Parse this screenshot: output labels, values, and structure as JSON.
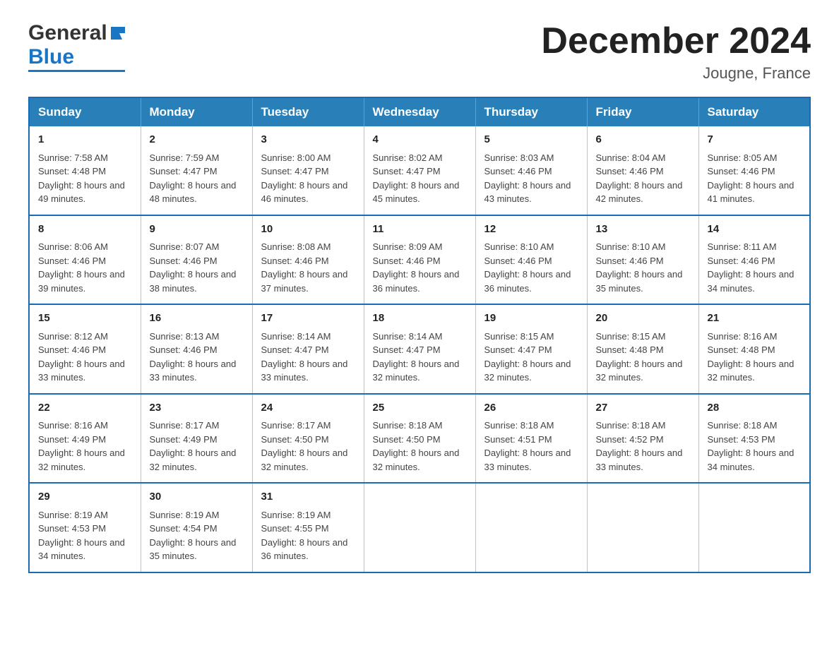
{
  "header": {
    "month_title": "December 2024",
    "location": "Jougne, France",
    "logo_general": "General",
    "logo_blue": "Blue"
  },
  "days_of_week": [
    "Sunday",
    "Monday",
    "Tuesday",
    "Wednesday",
    "Thursday",
    "Friday",
    "Saturday"
  ],
  "weeks": [
    [
      {
        "day": "1",
        "sunrise": "7:58 AM",
        "sunset": "4:48 PM",
        "daylight": "8 hours and 49 minutes."
      },
      {
        "day": "2",
        "sunrise": "7:59 AM",
        "sunset": "4:47 PM",
        "daylight": "8 hours and 48 minutes."
      },
      {
        "day": "3",
        "sunrise": "8:00 AM",
        "sunset": "4:47 PM",
        "daylight": "8 hours and 46 minutes."
      },
      {
        "day": "4",
        "sunrise": "8:02 AM",
        "sunset": "4:47 PM",
        "daylight": "8 hours and 45 minutes."
      },
      {
        "day": "5",
        "sunrise": "8:03 AM",
        "sunset": "4:46 PM",
        "daylight": "8 hours and 43 minutes."
      },
      {
        "day": "6",
        "sunrise": "8:04 AM",
        "sunset": "4:46 PM",
        "daylight": "8 hours and 42 minutes."
      },
      {
        "day": "7",
        "sunrise": "8:05 AM",
        "sunset": "4:46 PM",
        "daylight": "8 hours and 41 minutes."
      }
    ],
    [
      {
        "day": "8",
        "sunrise": "8:06 AM",
        "sunset": "4:46 PM",
        "daylight": "8 hours and 39 minutes."
      },
      {
        "day": "9",
        "sunrise": "8:07 AM",
        "sunset": "4:46 PM",
        "daylight": "8 hours and 38 minutes."
      },
      {
        "day": "10",
        "sunrise": "8:08 AM",
        "sunset": "4:46 PM",
        "daylight": "8 hours and 37 minutes."
      },
      {
        "day": "11",
        "sunrise": "8:09 AM",
        "sunset": "4:46 PM",
        "daylight": "8 hours and 36 minutes."
      },
      {
        "day": "12",
        "sunrise": "8:10 AM",
        "sunset": "4:46 PM",
        "daylight": "8 hours and 36 minutes."
      },
      {
        "day": "13",
        "sunrise": "8:10 AM",
        "sunset": "4:46 PM",
        "daylight": "8 hours and 35 minutes."
      },
      {
        "day": "14",
        "sunrise": "8:11 AM",
        "sunset": "4:46 PM",
        "daylight": "8 hours and 34 minutes."
      }
    ],
    [
      {
        "day": "15",
        "sunrise": "8:12 AM",
        "sunset": "4:46 PM",
        "daylight": "8 hours and 33 minutes."
      },
      {
        "day": "16",
        "sunrise": "8:13 AM",
        "sunset": "4:46 PM",
        "daylight": "8 hours and 33 minutes."
      },
      {
        "day": "17",
        "sunrise": "8:14 AM",
        "sunset": "4:47 PM",
        "daylight": "8 hours and 33 minutes."
      },
      {
        "day": "18",
        "sunrise": "8:14 AM",
        "sunset": "4:47 PM",
        "daylight": "8 hours and 32 minutes."
      },
      {
        "day": "19",
        "sunrise": "8:15 AM",
        "sunset": "4:47 PM",
        "daylight": "8 hours and 32 minutes."
      },
      {
        "day": "20",
        "sunrise": "8:15 AM",
        "sunset": "4:48 PM",
        "daylight": "8 hours and 32 minutes."
      },
      {
        "day": "21",
        "sunrise": "8:16 AM",
        "sunset": "4:48 PM",
        "daylight": "8 hours and 32 minutes."
      }
    ],
    [
      {
        "day": "22",
        "sunrise": "8:16 AM",
        "sunset": "4:49 PM",
        "daylight": "8 hours and 32 minutes."
      },
      {
        "day": "23",
        "sunrise": "8:17 AM",
        "sunset": "4:49 PM",
        "daylight": "8 hours and 32 minutes."
      },
      {
        "day": "24",
        "sunrise": "8:17 AM",
        "sunset": "4:50 PM",
        "daylight": "8 hours and 32 minutes."
      },
      {
        "day": "25",
        "sunrise": "8:18 AM",
        "sunset": "4:50 PM",
        "daylight": "8 hours and 32 minutes."
      },
      {
        "day": "26",
        "sunrise": "8:18 AM",
        "sunset": "4:51 PM",
        "daylight": "8 hours and 33 minutes."
      },
      {
        "day": "27",
        "sunrise": "8:18 AM",
        "sunset": "4:52 PM",
        "daylight": "8 hours and 33 minutes."
      },
      {
        "day": "28",
        "sunrise": "8:18 AM",
        "sunset": "4:53 PM",
        "daylight": "8 hours and 34 minutes."
      }
    ],
    [
      {
        "day": "29",
        "sunrise": "8:19 AM",
        "sunset": "4:53 PM",
        "daylight": "8 hours and 34 minutes."
      },
      {
        "day": "30",
        "sunrise": "8:19 AM",
        "sunset": "4:54 PM",
        "daylight": "8 hours and 35 minutes."
      },
      {
        "day": "31",
        "sunrise": "8:19 AM",
        "sunset": "4:55 PM",
        "daylight": "8 hours and 36 minutes."
      },
      null,
      null,
      null,
      null
    ]
  ],
  "labels": {
    "sunrise_prefix": "Sunrise: ",
    "sunset_prefix": "Sunset: ",
    "daylight_prefix": "Daylight: "
  },
  "colors": {
    "header_bg": "#2980b9",
    "header_text": "#ffffff",
    "border": "#1a6bb5",
    "logo_dark": "#333333",
    "logo_blue": "#1a75c4"
  }
}
